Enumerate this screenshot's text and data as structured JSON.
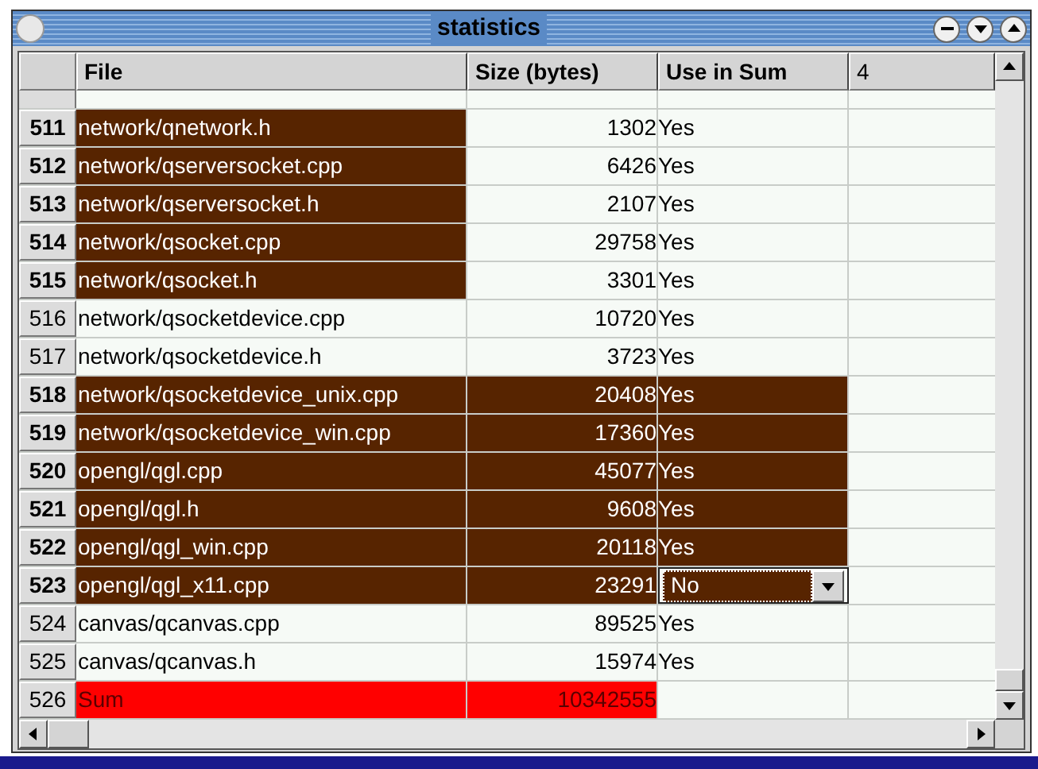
{
  "window": {
    "title": "statistics"
  },
  "table": {
    "columns": [
      "File",
      "Size (bytes)",
      "Use in Sum",
      "4"
    ],
    "rows": [
      {
        "kind": "data",
        "header": "511",
        "file": "network/qnetwork.h",
        "size": "1302",
        "use": "Yes",
        "file_selected": true,
        "size_selected": false,
        "use_selected": false
      },
      {
        "kind": "data",
        "header": "512",
        "file": "network/qserversocket.cpp",
        "size": "6426",
        "use": "Yes",
        "file_selected": true,
        "size_selected": false,
        "use_selected": false
      },
      {
        "kind": "data",
        "header": "513",
        "file": "network/qserversocket.h",
        "size": "2107",
        "use": "Yes",
        "file_selected": true,
        "size_selected": false,
        "use_selected": false
      },
      {
        "kind": "data",
        "header": "514",
        "file": "network/qsocket.cpp",
        "size": "29758",
        "use": "Yes",
        "file_selected": true,
        "size_selected": false,
        "use_selected": false
      },
      {
        "kind": "data",
        "header": "515",
        "file": "network/qsocket.h",
        "size": "3301",
        "use": "Yes",
        "file_selected": true,
        "size_selected": false,
        "use_selected": false
      },
      {
        "kind": "data",
        "header": "516",
        "file": "network/qsocketdevice.cpp",
        "size": "10720",
        "use": "Yes",
        "file_selected": false,
        "size_selected": false,
        "use_selected": false
      },
      {
        "kind": "data",
        "header": "517",
        "file": "network/qsocketdevice.h",
        "size": "3723",
        "use": "Yes",
        "file_selected": false,
        "size_selected": false,
        "use_selected": false
      },
      {
        "kind": "data",
        "header": "518",
        "file": "network/qsocketdevice_unix.cpp",
        "size": "20408",
        "use": "Yes",
        "file_selected": true,
        "size_selected": true,
        "use_selected": true
      },
      {
        "kind": "data",
        "header": "519",
        "file": "network/qsocketdevice_win.cpp",
        "size": "17360",
        "use": "Yes",
        "file_selected": true,
        "size_selected": true,
        "use_selected": true
      },
      {
        "kind": "data",
        "header": "520",
        "file": "opengl/qgl.cpp",
        "size": "45077",
        "use": "Yes",
        "file_selected": true,
        "size_selected": true,
        "use_selected": true
      },
      {
        "kind": "data",
        "header": "521",
        "file": "opengl/qgl.h",
        "size": "9608",
        "use": "Yes",
        "file_selected": true,
        "size_selected": true,
        "use_selected": true
      },
      {
        "kind": "data",
        "header": "522",
        "file": "opengl/qgl_win.cpp",
        "size": "20118",
        "use": "Yes",
        "file_selected": true,
        "size_selected": true,
        "use_selected": true
      },
      {
        "kind": "editor",
        "header": "523",
        "file": "opengl/qgl_x11.cpp",
        "size": "23291",
        "use": "No",
        "file_selected": true,
        "size_selected": true,
        "use_selected": true
      },
      {
        "kind": "data",
        "header": "524",
        "file": "canvas/qcanvas.cpp",
        "size": "89525",
        "use": "Yes",
        "file_selected": false,
        "size_selected": false,
        "use_selected": false
      },
      {
        "kind": "data",
        "header": "525",
        "file": "canvas/qcanvas.h",
        "size": "15974",
        "use": "Yes",
        "file_selected": false,
        "size_selected": false,
        "use_selected": false
      },
      {
        "kind": "sum",
        "header": "526",
        "file": "Sum",
        "size": "10342555"
      }
    ]
  }
}
